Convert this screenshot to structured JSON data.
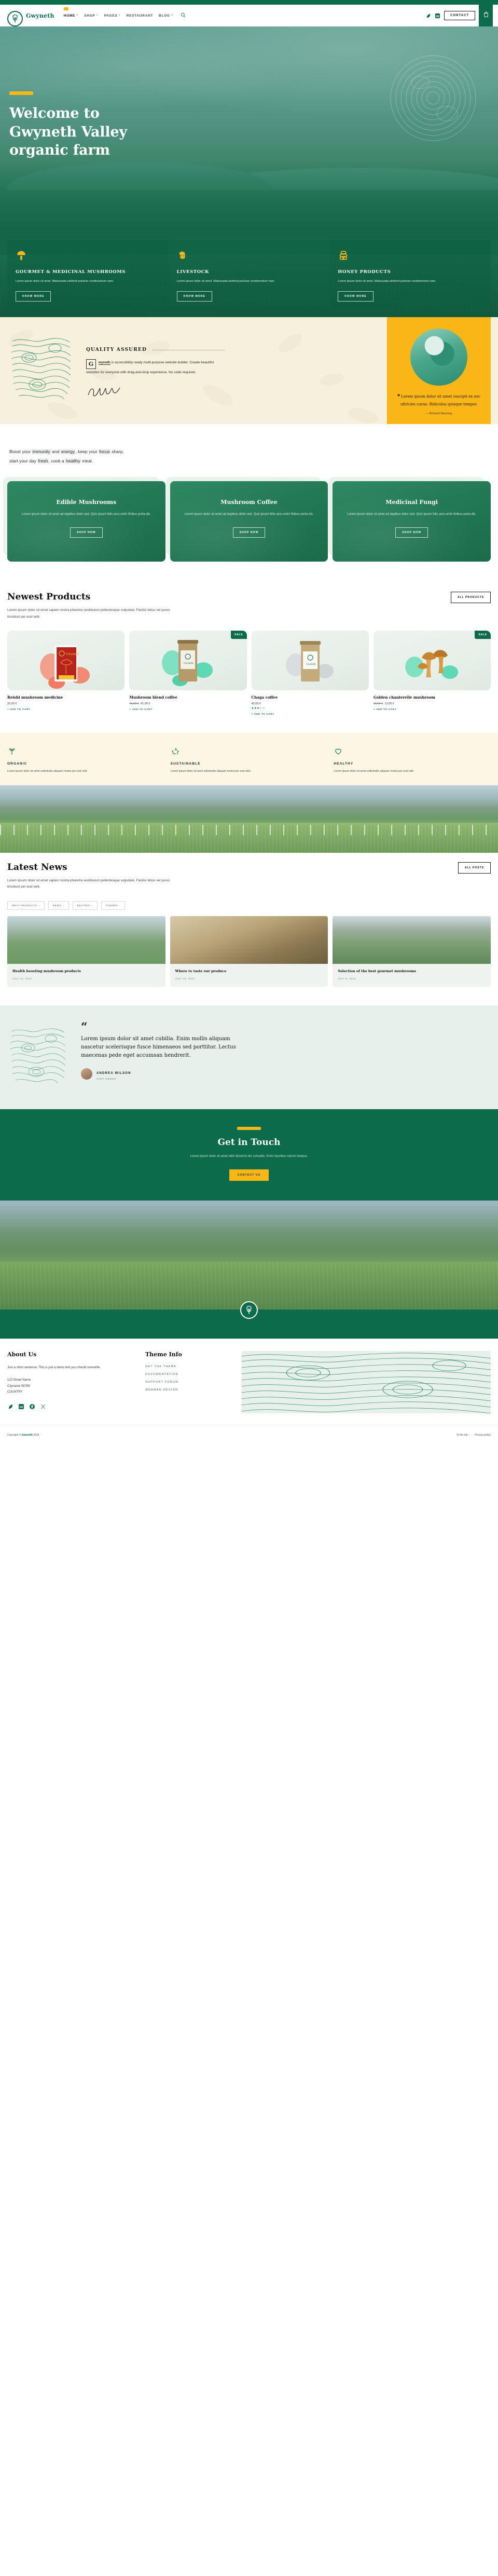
{
  "brand": {
    "name": "Gwyneth",
    "logo_icon": "gwyneth-tree-logo"
  },
  "nav": {
    "items": [
      {
        "label": "HOME",
        "has_submenu": true,
        "active": true
      },
      {
        "label": "SHOP",
        "has_submenu": true,
        "active": false
      },
      {
        "label": "PAGES",
        "has_submenu": true,
        "active": false
      },
      {
        "label": "RESTAURANT",
        "has_submenu": false,
        "active": false
      },
      {
        "label": "BLOG",
        "has_submenu": true,
        "active": false
      }
    ],
    "search_icon": "search-icon"
  },
  "header_actions": {
    "leaf_icon": "leaf-icon",
    "webman_icon": "webman-design-icon",
    "contact_label": "CONTACT",
    "cart_icon": "shopping-bag-icon"
  },
  "hero": {
    "title_line1": "Welcome to",
    "title_line2": "Gwyneth Valley",
    "title_line3": "organic farm",
    "cards": [
      {
        "icon": "mushroom-icon",
        "title": "GOURMET & MEDICINAL MUSHROOMS",
        "text": "Lorem ipsum dolor sit amet. Malesuada eleifend pulvinar condimentum nam.",
        "button": "KNOW MORE"
      },
      {
        "icon": "sheep-icon",
        "title": "LIVESTOCK",
        "text": "Lorem ipsum dolor sit amet. Malesuada eleifend pulvinar condimentum nam.",
        "button": "KNOW MORE"
      },
      {
        "icon": "beehive-icon",
        "title": "HONEY PRODUCTS",
        "text": "Lorem ipsum dolor sit amet. Malesuada eleifend pulvinar condimentum nam.",
        "button": "KNOW MORE"
      }
    ]
  },
  "quality": {
    "heading": "QUALITY ASSURED",
    "dropcap": "G",
    "body_strong": "wyneth",
    "body_rest": " is accessibility ready multi-purpose website builder. Create beautiful websites ",
    "body_italic": "for everyone",
    "body_end": " with drag-and-drop experience. No code required.",
    "signature_alt": "signature",
    "testimonial": {
      "quote": "Lorem ipsum dolor sit amet suscipit ex nec ultricies curae. Ridiculus quisque tempor.",
      "author": "— Richard Manning",
      "photo_alt": "farmer-with-sheep-photo"
    }
  },
  "boost": {
    "line1_a": "Boost your ",
    "line1_hl1": "immunity",
    "line1_b": " and ",
    "line1_hl2": "energy",
    "line1_c": ", keep your ",
    "line1_hl3": "focus",
    "line1_d": " sharp,",
    "line2_a": "start your day ",
    "line2_hl1": "fresh",
    "line2_b": ", cook a ",
    "line2_hl2": "healthy",
    "line2_c": " meal."
  },
  "categories": [
    {
      "title": "Edible Mushrooms",
      "text": "Lorem ipsum dolor sit amet ad dapibus dolor sed. Quis ipsum felis arcu enim finibus porta dis.",
      "button": "SHOP NOW"
    },
    {
      "title": "Mushroom Coffee",
      "text": "Lorem ipsum dolor sit amet ad dapibus dolor sed. Quis ipsum felis arcu enim finibus porta dis.",
      "button": "SHOP NOW"
    },
    {
      "title": "Medicinal Fungi",
      "text": "Lorem ipsum dolor sit amet ad dapibus dolor sed. Quis ipsum felis arcu enim finibus porta dis.",
      "button": "SHOP NOW"
    }
  ],
  "newest": {
    "title": "Newest Products",
    "subtitle": "Lorem ipsum dolor sit amet sapien nostra pharetra vestibulum pellentesque vulputate. Facilisi letius vel purus tincidunt per erat velit.",
    "all_label": "ALL PRODUCTS",
    "products": [
      {
        "name": "Reishi mushroom medicine",
        "price": "32,00 €",
        "old_price": "",
        "badge": "",
        "rating": 0,
        "cart_label": "+ ADD TO CART",
        "image_alt": "reishi-medicine-box"
      },
      {
        "name": "Mushroom blend coffee",
        "price": "41,00 €",
        "old_price": "48,00 €",
        "badge": "SALE",
        "rating": 0,
        "cart_label": "+ ADD TO CART",
        "image_alt": "mushroom-blend-coffee-bag"
      },
      {
        "name": "Chaga coffee",
        "price": "45,00 €",
        "old_price": "",
        "badge": "",
        "rating": 3,
        "cart_label": "+ ADD TO CART",
        "image_alt": "chaga-coffee-bag"
      },
      {
        "name": "Golden chanterelle mushroom",
        "price": "13,00 €",
        "old_price": "18,00 €",
        "badge": "SALE",
        "rating": 0,
        "cart_label": "+ ADD TO CART",
        "image_alt": "golden-chanterelle-mushrooms"
      }
    ]
  },
  "features": [
    {
      "icon": "sprout-icon",
      "title": "ORGANIC",
      "text": "Lorem ipsum dolor sit amet sollicitudin aliquam nostra per erat velit."
    },
    {
      "icon": "recycle-icon",
      "title": "SUSTAINABLE",
      "text": "Lorem ipsum dolor sit amet sollicitudin aliquam nostra per erat velit."
    },
    {
      "icon": "heart-icon",
      "title": "HEALTHY",
      "text": "Lorem ipsum dolor sit amet sollicitudin aliquam nostra per erat velit."
    }
  ],
  "news": {
    "title": "Latest News",
    "subtitle": "Lorem ipsum dolor sit amet sapien nostra pharetra vestibulum pellentesque vulputate. Facilisi letius vel purus tincidunt per erat velit.",
    "all_label": "ALL POSTS",
    "chips": [
      {
        "label": "MEAT PRODUCTS"
      },
      {
        "label": "NEWS"
      },
      {
        "label": "RECIPES"
      },
      {
        "label": "THEMES"
      }
    ],
    "posts": [
      {
        "title": "Health boosting mushroom products",
        "date": "JULY 11, 2023",
        "image_alt": "green-pasture-photo"
      },
      {
        "title": "Where to taste our produce",
        "date": "JULY 10, 2023",
        "image_alt": "hand-holding-mushroom-photo"
      },
      {
        "title": "Selection of the best gourmet mushrooms",
        "date": "JULY 8, 2023",
        "image_alt": "valley-landscape-photo"
      }
    ]
  },
  "testimonial": {
    "mark": "“",
    "quote": "Lorem ipsum dolor sit amet cubilia. Enim mollis aliquam nascetur scelerisque fusce himenaeos sed porttitor. Lectus maecenas pede eget accumsan hendrerit.",
    "name": "ANDREA WILSON",
    "role": "CHEF OWNER"
  },
  "touch": {
    "title": "Get in Touch",
    "text": "Lorem ipsum dolor sit amet nibh dictumst dui convallis. Enim faucibus rutrum tempus.",
    "button": "CONTACT US"
  },
  "footer": {
    "about_title": "About Us",
    "about_text": "Just a short sentence. This is just a demo text you should overwrite.",
    "address_line1": "123 Street Name",
    "address_line2": "Cityname 56789",
    "address_line3": "COUNTRY",
    "social": [
      {
        "icon": "leaf-icon"
      },
      {
        "icon": "webman-design-icon"
      },
      {
        "icon": "facebook-icon"
      },
      {
        "icon": "x-twitter-icon"
      }
    ],
    "theme_title": "Theme Info",
    "theme_links": [
      {
        "label": "GET THE THEME"
      },
      {
        "label": "DOCUMENTATION"
      },
      {
        "label": "SUPPORT FORUM"
      },
      {
        "label": "WEBMAN DESIGN"
      }
    ],
    "copyright_pre": "Copyright © ",
    "copyright_brand": "Gwyneth",
    "copyright_post": " 2024",
    "bottom_links": [
      {
        "label": "To the top ↑"
      },
      {
        "label": "Privacy policy"
      }
    ]
  }
}
